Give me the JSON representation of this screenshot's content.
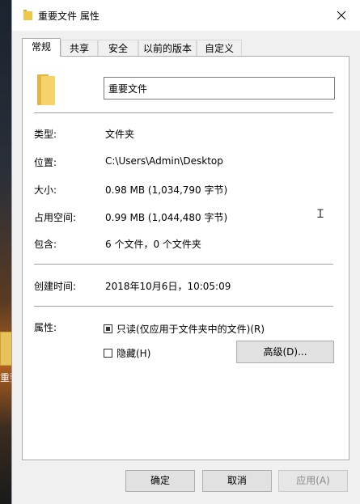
{
  "window": {
    "title": "重要文件 属性"
  },
  "desktop": {
    "icon_label": "重要"
  },
  "tabs": [
    {
      "label": "常规",
      "active": true
    },
    {
      "label": "共享",
      "active": false
    },
    {
      "label": "安全",
      "active": false
    },
    {
      "label": "以前的版本",
      "active": false
    },
    {
      "label": "自定义",
      "active": false
    }
  ],
  "general": {
    "name_value": "重要文件",
    "type_label": "类型:",
    "type_value": "文件夹",
    "location_label": "位置:",
    "location_value": "C:\\Users\\Admin\\Desktop",
    "size_label": "大小:",
    "size_value": "0.98 MB (1,034,790 字节)",
    "size_on_disk_label": "占用空间:",
    "size_on_disk_value": "0.99 MB (1,044,480 字节)",
    "contains_label": "包含:",
    "contains_value": "6 个文件，0 个文件夹",
    "created_label": "创建时间:",
    "created_value": "2018年10月6日，10:05:09",
    "attributes_label": "属性:",
    "readonly_label": "只读(仅应用于文件夹中的文件)(R)",
    "readonly_state": "indeterminate",
    "hidden_label": "隐藏(H)",
    "hidden_checked": false,
    "advanced_label": "高级(D)..."
  },
  "buttons": {
    "ok": "确定",
    "cancel": "取消",
    "apply": "应用(A)",
    "apply_enabled": false
  },
  "colors": {
    "folder_yellow": "#f0c64d",
    "dialog_bg": "#f0f0f0",
    "panel_bg": "#ffffff"
  }
}
